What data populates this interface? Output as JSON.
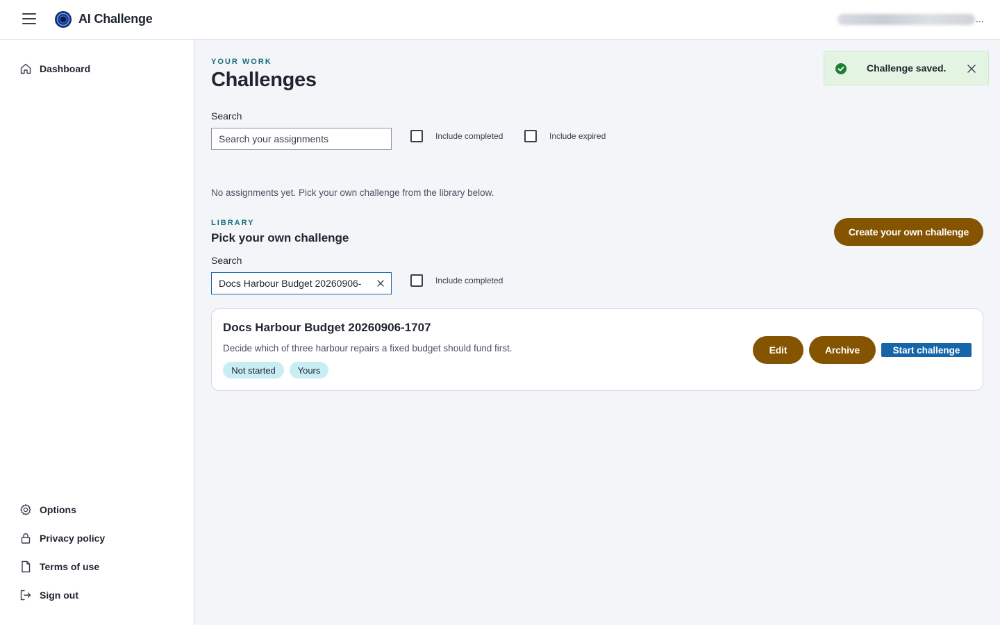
{
  "header": {
    "app_title": "AI Challenge",
    "user_ellipsis": "..."
  },
  "sidebar": {
    "top_items": [
      {
        "label": "Dashboard",
        "icon": "home-icon"
      }
    ],
    "bottom_items": [
      {
        "label": "Options",
        "icon": "gear-icon"
      },
      {
        "label": "Privacy policy",
        "icon": "lock-icon"
      },
      {
        "label": "Terms of use",
        "icon": "document-icon"
      },
      {
        "label": "Sign out",
        "icon": "sign-out-icon"
      }
    ]
  },
  "your_work": {
    "eyebrow": "YOUR WORK",
    "title": "Challenges",
    "search_label": "Search",
    "search_placeholder": "Search your assignments",
    "include_completed": "Include completed",
    "include_expired": "Include expired",
    "empty_note": "No assignments yet. Pick your own challenge from the library below."
  },
  "library": {
    "eyebrow": "LIBRARY",
    "title": "Pick your own challenge",
    "create_button": "Create your own challenge",
    "search_label": "Search",
    "search_value": "Docs Harbour Budget 20260906-",
    "include_completed": "Include completed"
  },
  "card": {
    "title": "Docs Harbour Budget 20260906-1707",
    "description": "Decide which of three harbour repairs a fixed budget should fund first.",
    "chips": [
      "Not started",
      "Yours"
    ],
    "edit_button": "Edit",
    "archive_button": "Archive",
    "start_button": "Start challenge"
  },
  "toast": {
    "message": "Challenge saved.",
    "icon": "check-circle-icon"
  },
  "colors": {
    "accent_brown": "#845400",
    "accent_blue": "#1565a8",
    "eyebrow_teal": "#156d7c",
    "chip_bg": "#c8eef4",
    "toast_bg": "#e3f4e3",
    "success_green": "#1e7e34"
  }
}
